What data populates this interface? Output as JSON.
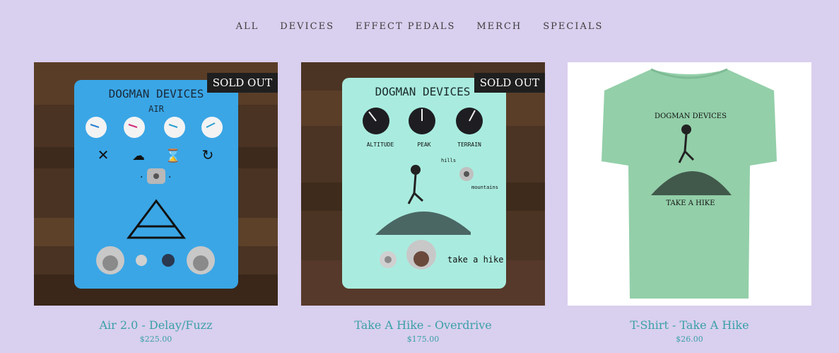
{
  "colors": {
    "background": "#d9cfee",
    "link": "#3aa0a8",
    "badge_bg": "#1f1f1f"
  },
  "nav": {
    "items": [
      {
        "label": "ALL"
      },
      {
        "label": "DEVICES"
      },
      {
        "label": "EFFECT PEDALS"
      },
      {
        "label": "MERCH"
      },
      {
        "label": "SPECIALS"
      }
    ]
  },
  "products": [
    {
      "title": "Air 2.0 - Delay/Fuzz",
      "price": "$225.00",
      "badge": "SOLD OUT",
      "image": {
        "brand": "DOGMAN DEVICES",
        "model": "AIR",
        "pedal_color": "#3aa6e6"
      }
    },
    {
      "title": "Take A Hike - Overdrive",
      "price": "$175.00",
      "badge": "SOLD OUT",
      "image": {
        "brand": "DOGMAN DEVICES",
        "knob_labels": [
          "ALTITUDE",
          "PEAK",
          "TERRAIN"
        ],
        "switch_labels": [
          "hills",
          "mountains"
        ],
        "footer": "take a hike",
        "pedal_color": "#a9ecdf"
      }
    },
    {
      "title": "T-Shirt - Take A Hike",
      "price": "$26.00",
      "badge": "",
      "image": {
        "shirt_text_top": "DOGMAN DEVICES",
        "shirt_text_bottom": "TAKE A HIKE",
        "shirt_color": "#93cfa9"
      }
    }
  ]
}
